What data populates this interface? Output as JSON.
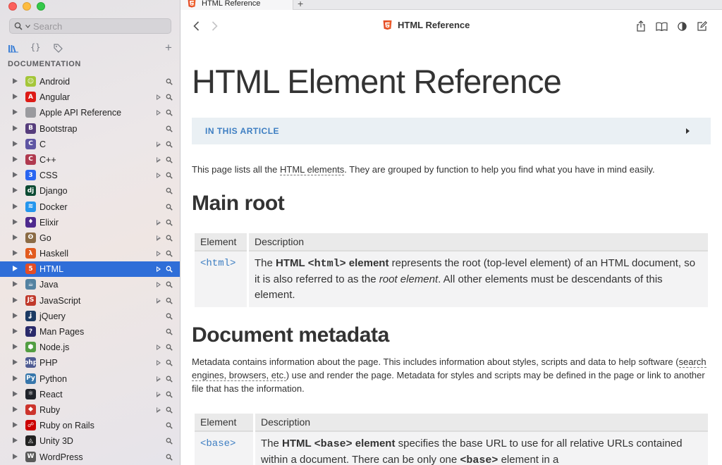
{
  "sidebar": {
    "search_placeholder": "Search",
    "section_label": "DOCUMENTATION",
    "items": [
      {
        "name": "Android",
        "icon": "android-icon",
        "color": "#a4c639",
        "glyph": "☺",
        "play": false,
        "selected": false
      },
      {
        "name": "Angular",
        "icon": "angular-icon",
        "color": "#dd1b16",
        "glyph": "A",
        "play": true,
        "selected": false
      },
      {
        "name": "Apple API Reference",
        "icon": "apple-icon",
        "color": "#9a9a9e",
        "glyph": "",
        "play": true,
        "selected": false
      },
      {
        "name": "Bootstrap",
        "icon": "bootstrap-icon",
        "color": "#563d7c",
        "glyph": "B",
        "play": false,
        "selected": false
      },
      {
        "name": "C",
        "icon": "c-icon",
        "color": "#5e55a3",
        "glyph": "C",
        "play": true,
        "selected": false
      },
      {
        "name": "C++",
        "icon": "cpp-icon",
        "color": "#b03a4f",
        "glyph": "C",
        "play": true,
        "selected": false
      },
      {
        "name": "CSS",
        "icon": "css-icon",
        "color": "#2965f1",
        "glyph": "3",
        "play": true,
        "selected": false
      },
      {
        "name": "Django",
        "icon": "django-icon",
        "color": "#0c4b33",
        "glyph": "dj",
        "play": false,
        "selected": false
      },
      {
        "name": "Docker",
        "icon": "docker-icon",
        "color": "#2496ed",
        "glyph": "≋",
        "play": false,
        "selected": false
      },
      {
        "name": "Elixir",
        "icon": "elixir-icon",
        "color": "#4e2a8e",
        "glyph": "♦",
        "play": true,
        "selected": false
      },
      {
        "name": "Go",
        "icon": "go-icon",
        "color": "#8b6b45",
        "glyph": "ʘ",
        "play": true,
        "selected": false
      },
      {
        "name": "Haskell",
        "icon": "haskell-icon",
        "color": "#e25b1f",
        "glyph": "λ",
        "play": true,
        "selected": false
      },
      {
        "name": "HTML",
        "icon": "html5-icon",
        "color": "#e44d26",
        "glyph": "5",
        "play": true,
        "selected": true
      },
      {
        "name": "Java",
        "icon": "java-icon",
        "color": "#5382a1",
        "glyph": "☕",
        "play": true,
        "selected": false
      },
      {
        "name": "JavaScript",
        "icon": "javascript-icon",
        "color": "#c0392b",
        "glyph": "JS",
        "play": true,
        "selected": false
      },
      {
        "name": "jQuery",
        "icon": "jquery-icon",
        "color": "#1b3a63",
        "glyph": "ʝ",
        "play": false,
        "selected": false
      },
      {
        "name": "Man Pages",
        "icon": "man-pages-icon",
        "color": "#2a2a6a",
        "glyph": "?",
        "play": false,
        "selected": false
      },
      {
        "name": "Node.js",
        "icon": "nodejs-icon",
        "color": "#539e43",
        "glyph": "⬢",
        "play": true,
        "selected": false
      },
      {
        "name": "PHP",
        "icon": "php-icon",
        "color": "#4f5b93",
        "glyph": "php",
        "play": true,
        "selected": false
      },
      {
        "name": "Python",
        "icon": "python-icon",
        "color": "#3776ab",
        "glyph": "Py",
        "play": true,
        "selected": false
      },
      {
        "name": "React",
        "icon": "react-icon",
        "color": "#20232a",
        "glyph": "⚛",
        "play": true,
        "selected": false
      },
      {
        "name": "Ruby",
        "icon": "ruby-icon",
        "color": "#cc342d",
        "glyph": "◆",
        "play": true,
        "selected": false
      },
      {
        "name": "Ruby on Rails",
        "icon": "rails-icon",
        "color": "#cc0000",
        "glyph": "☍",
        "play": false,
        "selected": false
      },
      {
        "name": "Unity 3D",
        "icon": "unity-icon",
        "color": "#222222",
        "glyph": "◬",
        "play": false,
        "selected": false
      },
      {
        "name": "WordPress",
        "icon": "wordpress-icon",
        "color": "#5a5a5a",
        "glyph": "W",
        "play": false,
        "selected": false
      }
    ]
  },
  "tab": {
    "title": "HTML Reference",
    "new_tab": "+"
  },
  "toolbar": {
    "title": "HTML Reference"
  },
  "article": {
    "title": "HTML Element Reference",
    "toc_label": "IN THIS ARTICLE",
    "intro_before": "This page lists all the ",
    "intro_link": "HTML elements",
    "intro_after": ". They are grouped by function to help you find what you have in mind easily.",
    "main_root": {
      "heading": "Main root",
      "col_element": "Element",
      "col_description": "Description",
      "row_element": "<html>",
      "desc_1": "The ",
      "desc_strong_1": "HTML ",
      "desc_code": "<html>",
      "desc_strong_2": " element",
      "desc_2": " represents the root (top-level element) of an HTML document, so it is also referred to as the ",
      "desc_em": "root element",
      "desc_3": ". All other elements must be descendants of this element."
    },
    "metadata": {
      "heading": "Document metadata",
      "para_1": "Metadata contains information about the page. This includes information about styles, scripts and data to help software (",
      "para_link": "search engines, browsers, etc.",
      "para_2": ") use and render the page. Metadata for styles and scripts may be defined in the page or link to another file that has the information.",
      "col_element": "Element",
      "col_description": "Description",
      "row_element": "<base>",
      "desc_1": "The ",
      "desc_strong_1": "HTML ",
      "desc_code": "<base>",
      "desc_strong_2": " element",
      "desc_2": " specifies the base URL to use for all relative URLs contained within a document. There can be only one ",
      "desc_code_2": "<base>",
      "desc_3": " element in a"
    }
  }
}
